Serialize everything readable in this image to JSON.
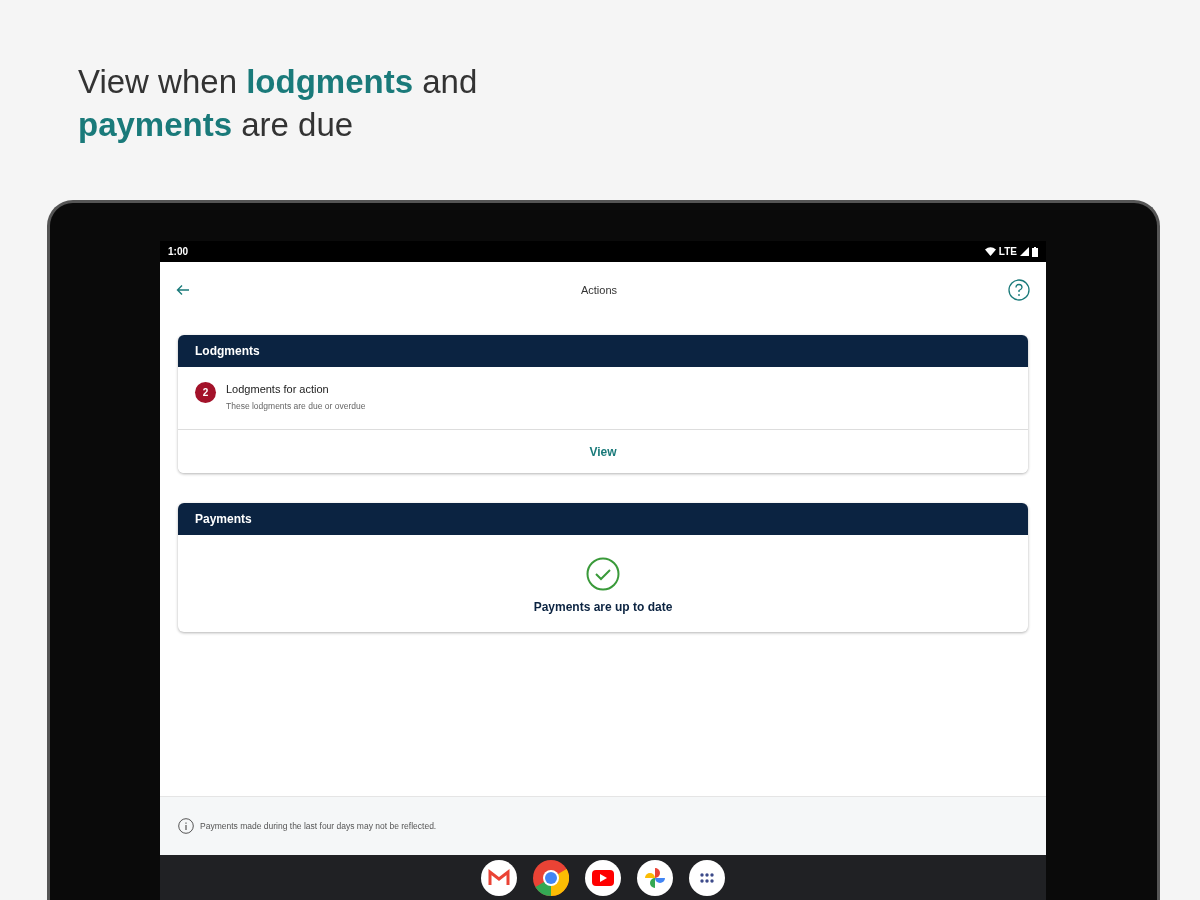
{
  "headline": "View when **lodgments** and **payments** are due",
  "status_bar": {
    "time": "1:00",
    "network": "LTE"
  },
  "app_bar": {
    "title": "Actions"
  },
  "cards": [
    {
      "kind": "list",
      "title": "Lodgments",
      "item": {
        "badge": "2",
        "title": "Lodgments for action",
        "subtitle": "These lodgments are due or overdue"
      },
      "action": "View"
    },
    {
      "kind": "status",
      "title": "Payments",
      "message": "Payments are up to date"
    }
  ],
  "footer_note": "Payments made during the last four days may not be reflected."
}
